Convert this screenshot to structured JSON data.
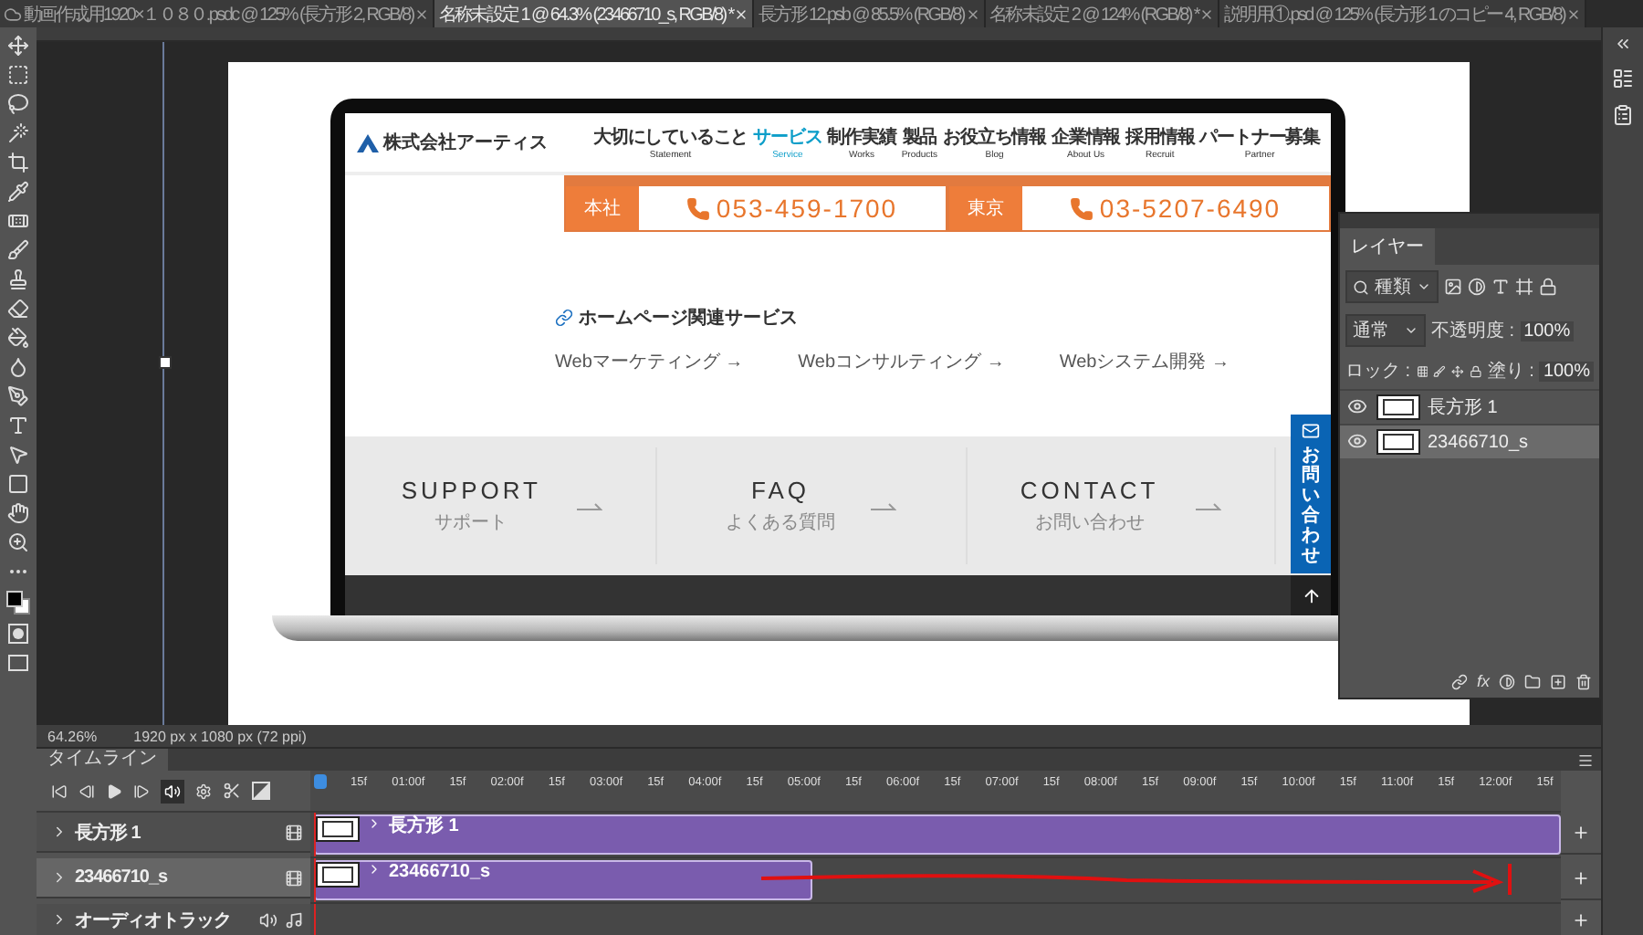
{
  "tabs": [
    {
      "label": "動画作成用1920×１０８０.psdc @ 125% (長方形 2, RGB/8)",
      "selected": false,
      "cloud": true
    },
    {
      "label": "名称未設定 1 @ 64.3% (23466710_s, RGB/8) *",
      "selected": true,
      "cloud": false
    },
    {
      "label": "長方形 12.psb @ 85.5% (RGB/8)",
      "selected": false,
      "cloud": false
    },
    {
      "label": "名称未設定 2 @ 124% (RGB/8) *",
      "selected": false,
      "cloud": false
    },
    {
      "label": "説明用①.psd @ 125% (長方形 1 のコピー 4, RGB/8)",
      "selected": false,
      "cloud": false
    }
  ],
  "website": {
    "logo": "株式会社アーティス",
    "nav": [
      {
        "label": "大切にしていること",
        "sub": "Statement",
        "selected": false
      },
      {
        "label": "サービス",
        "sub": "Service",
        "selected": true
      },
      {
        "label": "制作実績",
        "sub": "Works",
        "selected": false
      },
      {
        "label": "製品",
        "sub": "Products",
        "selected": false
      },
      {
        "label": "お役立ち情報",
        "sub": "Blog",
        "selected": false
      },
      {
        "label": "企業情報",
        "sub": "About Us",
        "selected": false
      },
      {
        "label": "採用情報",
        "sub": "Recruit",
        "selected": false
      },
      {
        "label": "パートナー募集",
        "sub": "Partner",
        "selected": false
      }
    ],
    "phones": [
      {
        "label": "本社",
        "number": "053-459-1700"
      },
      {
        "label": "東京",
        "number": "03-5207-6490"
      }
    ],
    "section_title": "ホームページ関連サービス",
    "links": [
      "Webマーケティング →",
      "Webコンサルティング →",
      "Webシステム開発 →"
    ],
    "cards": [
      {
        "title": "SUPPORT",
        "subtitle": "サポート"
      },
      {
        "title": "FAQ",
        "subtitle": "よくある質問"
      },
      {
        "title": "CONTACT",
        "subtitle": "お問い合わせ"
      }
    ],
    "side_tab": "お問い合わせ"
  },
  "layers_panel": {
    "title": "レイヤー",
    "filter": "種類",
    "blend_mode": "通常",
    "opacity_label": "不透明度 :",
    "opacity": "100%",
    "lock_label": "ロック :",
    "fill_label": "塗り :",
    "fill": "100%",
    "fx_label": "fx",
    "layers": [
      {
        "name": "長方形 1",
        "selected": false,
        "visible": true
      },
      {
        "name": "23466710_s",
        "selected": true,
        "visible": true
      }
    ]
  },
  "status_bar": {
    "zoom": "64.26%",
    "doc_size": "1920 px x 1080 px (72 ppi)"
  },
  "timeline": {
    "title": "タイムライン",
    "audio_enabled": true,
    "ruler": [
      "15f",
      "01:00f",
      "15f",
      "02:00f",
      "15f",
      "03:00f",
      "15f",
      "04:00f",
      "15f",
      "05:00f",
      "15f",
      "06:00f",
      "15f",
      "07:00f",
      "15f",
      "08:00f",
      "15f",
      "09:00f",
      "15f",
      "10:00f",
      "15f",
      "11:00f",
      "15f",
      "12:00f",
      "15f"
    ],
    "tracks": [
      {
        "name": "長方形 1",
        "kind": "video",
        "clip": "長方形 1",
        "level": 1,
        "selected": false
      },
      {
        "name": "23466710_s",
        "kind": "video",
        "clip": "23466710_s",
        "level": 0.4,
        "selected": true
      },
      {
        "name": "オーディオトラック",
        "kind": "audio",
        "selected": false
      }
    ]
  }
}
